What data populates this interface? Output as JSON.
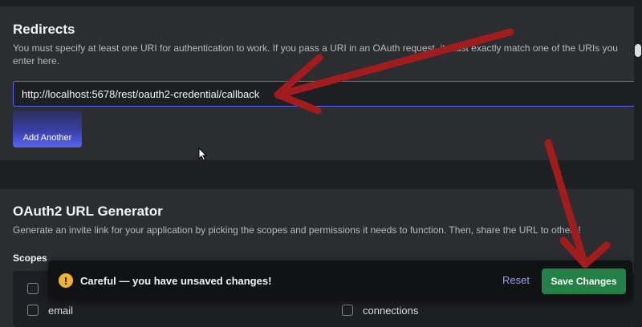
{
  "redirects": {
    "title": "Redirects",
    "description": "You must specify at least one URI for authentication to work. If you pass a URI in an OAuth request, it must exactly match one of the URIs you enter here.",
    "uri_value": "http://localhost:5678/rest/oauth2-credential/callback",
    "add_another_label": "Add Another"
  },
  "generator": {
    "title": "OAuth2 URL Generator",
    "description": "Generate an invite link for your application by picking the scopes and permissions it needs to function. Then, share the URL to others!",
    "scopes_label": "Scopes",
    "scopes": [
      "email",
      "connections"
    ]
  },
  "unsaved_notice": {
    "icon": "warning-icon",
    "message": "Careful — you have unsaved changes!",
    "reset_label": "Reset",
    "save_label": "Save Changes"
  },
  "colors": {
    "background": "#1e1f22",
    "panel": "#2b2d31",
    "accent": "#5865f2",
    "success": "#248046",
    "warning": "#f0b232",
    "annotation_arrow": "#a11d1d"
  }
}
